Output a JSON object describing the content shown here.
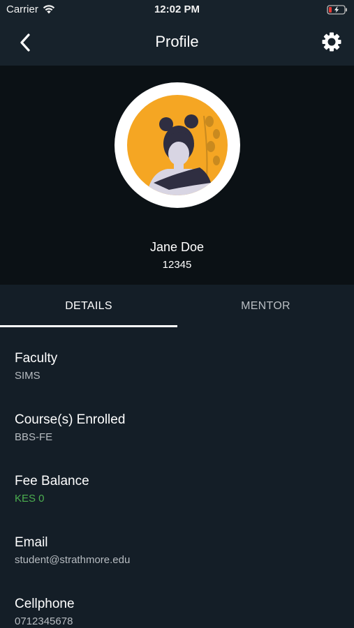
{
  "status_bar": {
    "carrier": "Carrier",
    "time": "12:02 PM"
  },
  "header": {
    "title": "Profile"
  },
  "profile": {
    "name": "Jane Doe",
    "id": "12345"
  },
  "tabs": [
    {
      "label": "DETAILS",
      "active": true
    },
    {
      "label": "MENTOR",
      "active": false
    }
  ],
  "details": [
    {
      "label": "Faculty",
      "value": "SIMS"
    },
    {
      "label": "Course(s) Enrolled",
      "value": "BBS-FE"
    },
    {
      "label": "Fee Balance",
      "value": "KES 0"
    },
    {
      "label": "Email",
      "value": "student@strathmore.edu"
    },
    {
      "label": "Cellphone",
      "value": "0712345678"
    }
  ],
  "colors": {
    "background": "#141e27",
    "hero_background": "#0b1115",
    "accent_green": "#4caf50",
    "avatar_bg": "#f5a623"
  }
}
